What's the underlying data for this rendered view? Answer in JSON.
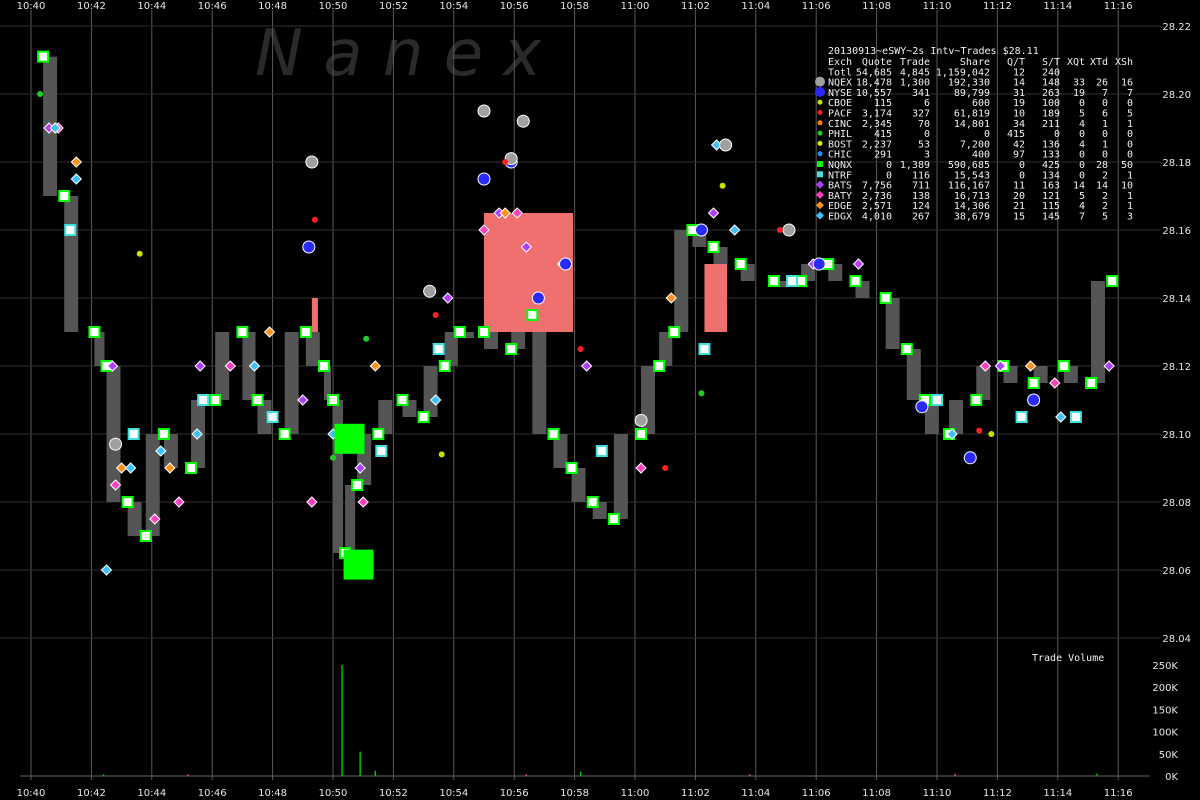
{
  "chart_data": {
    "type": "scatter",
    "title": "20130913~eSWY~2s Intv~Trades $28.11",
    "watermark": "N a n e x",
    "background": "#000000",
    "gridline_color": "#5a5a5a",
    "x_ticks": [
      "10:40",
      "10:42",
      "10:44",
      "10:46",
      "10:48",
      "10:50",
      "10:52",
      "10:54",
      "10:56",
      "10:58",
      "11:00",
      "11:02",
      "11:04",
      "11:06",
      "11:08",
      "11:10",
      "11:12",
      "11:14",
      "11:16"
    ],
    "x_range_minutes": [
      0,
      36.5
    ],
    "y_ticks": [
      "28.22",
      "28.20",
      "28.18",
      "28.16",
      "28.14",
      "28.12",
      "28.10",
      "28.08",
      "28.06",
      "28.04"
    ],
    "ylim": [
      28.04,
      28.22
    ],
    "volume_panel": {
      "label": "Trade Volume",
      "y_ticks": [
        "250K",
        "200K",
        "150K",
        "100K",
        "50K",
        "0K"
      ],
      "ylim": [
        0,
        250000
      ],
      "spikes": [
        {
          "t": 10.3,
          "v": 250000,
          "color": "#00c000"
        },
        {
          "t": 10.9,
          "v": 55000,
          "color": "#00c000"
        },
        {
          "t": 11.4,
          "v": 12000,
          "color": "#00c000"
        },
        {
          "t": 18.2,
          "v": 10000,
          "color": "#00c000"
        },
        {
          "t": 2.4,
          "v": 4000,
          "color": "#00c000"
        },
        {
          "t": 5.2,
          "v": 4000,
          "color": "#e05050"
        },
        {
          "t": 16.4,
          "v": 4000,
          "color": "#e05050"
        },
        {
          "t": 23.8,
          "v": 4000,
          "color": "#e05050"
        },
        {
          "t": 30.6,
          "v": 5000,
          "color": "#e05050"
        },
        {
          "t": 35.3,
          "v": 6000,
          "color": "#00c000"
        }
      ]
    },
    "legend": {
      "header": [
        "Exch",
        "Quote",
        "Trade",
        "Share",
        "Q/T",
        "S/T",
        "XQt",
        "XTd",
        "XSh"
      ],
      "rows": [
        {
          "marker": "none",
          "color": "#ffffff",
          "cells": [
            "Totl",
            "54,685",
            "4,845",
            "1,159,042",
            "12",
            "240",
            "",
            "",
            ""
          ]
        },
        {
          "marker": "circle",
          "color": "#a0a0a0",
          "cells": [
            "NQEX",
            "18,478",
            "1,300",
            "192,330",
            "14",
            "148",
            "33",
            "26",
            "16"
          ]
        },
        {
          "marker": "circle",
          "color": "#2a2aff",
          "cells": [
            "NYSE",
            "10,557",
            "341",
            "89,799",
            "31",
            "263",
            "19",
            "7",
            "7"
          ]
        },
        {
          "marker": "dot",
          "color": "#c8e000",
          "cells": [
            "CBOE",
            "115",
            "6",
            "600",
            "19",
            "100",
            "0",
            "0",
            "0"
          ]
        },
        {
          "marker": "dot",
          "color": "#ff2020",
          "cells": [
            "PACF",
            "3,174",
            "327",
            "61,819",
            "10",
            "189",
            "5",
            "6",
            "5"
          ]
        },
        {
          "marker": "dot",
          "color": "#ff8000",
          "cells": [
            "CINC",
            "2,345",
            "70",
            "14,801",
            "34",
            "211",
            "4",
            "1",
            "1"
          ]
        },
        {
          "marker": "dot",
          "color": "#20d020",
          "cells": [
            "PHIL",
            "415",
            "0",
            "0",
            "415",
            "0",
            "0",
            "0",
            "0"
          ]
        },
        {
          "marker": "dot",
          "color": "#d0f000",
          "cells": [
            "BOST",
            "2,237",
            "53",
            "7,200",
            "42",
            "136",
            "4",
            "1",
            "0"
          ]
        },
        {
          "marker": "dot",
          "color": "#2090ff",
          "cells": [
            "CHIC",
            "291",
            "3",
            "400",
            "97",
            "133",
            "0",
            "0",
            "0"
          ]
        },
        {
          "marker": "square",
          "color": "#00ff00",
          "cells": [
            "NQNX",
            "0",
            "1,389",
            "590,685",
            "0",
            "425",
            "0",
            "28",
            "50"
          ]
        },
        {
          "marker": "square",
          "color": "#40e0e0",
          "cells": [
            "NTRF",
            "0",
            "116",
            "15,543",
            "0",
            "134",
            "0",
            "2",
            "1"
          ]
        },
        {
          "marker": "diamond",
          "color": "#b040ff",
          "cells": [
            "BATS",
            "7,756",
            "711",
            "116,167",
            "11",
            "163",
            "14",
            "14",
            "10"
          ]
        },
        {
          "marker": "diamond",
          "color": "#ff40c0",
          "cells": [
            "BATY",
            "2,736",
            "138",
            "16,713",
            "20",
            "121",
            "5",
            "2",
            "1"
          ]
        },
        {
          "marker": "diamond",
          "color": "#ff9020",
          "cells": [
            "EDGE",
            "2,571",
            "124",
            "14,306",
            "21",
            "115",
            "4",
            "2",
            "1"
          ]
        },
        {
          "marker": "diamond",
          "color": "#40c0ff",
          "cells": [
            "EDGX",
            "4,010",
            "267",
            "38,679",
            "15",
            "145",
            "7",
            "5",
            "3"
          ]
        }
      ]
    },
    "series": [
      {
        "name": "NQNX",
        "marker": "square",
        "color": "#00ff00",
        "points": [
          [
            0.4,
            28.211
          ],
          [
            1.1,
            28.17
          ],
          [
            2.1,
            28.13
          ],
          [
            2.5,
            28.12
          ],
          [
            3.2,
            28.08
          ],
          [
            3.8,
            28.07
          ],
          [
            4.4,
            28.1
          ],
          [
            5.3,
            28.09
          ],
          [
            6.1,
            28.11
          ],
          [
            7.0,
            28.13
          ],
          [
            7.5,
            28.11
          ],
          [
            8.4,
            28.1
          ],
          [
            9.1,
            28.13
          ],
          [
            9.7,
            28.12
          ],
          [
            10.0,
            28.11
          ],
          [
            10.4,
            28.065
          ],
          [
            10.8,
            28.085
          ],
          [
            11.5,
            28.1
          ],
          [
            12.3,
            28.11
          ],
          [
            13.0,
            28.105
          ],
          [
            13.7,
            28.12
          ],
          [
            14.2,
            28.13
          ],
          [
            15.0,
            28.13
          ],
          [
            15.9,
            28.125
          ],
          [
            16.6,
            28.135
          ],
          [
            17.3,
            28.1
          ],
          [
            17.9,
            28.09
          ],
          [
            18.6,
            28.08
          ],
          [
            19.3,
            28.075
          ],
          [
            20.2,
            28.1
          ],
          [
            20.8,
            28.12
          ],
          [
            21.3,
            28.13
          ],
          [
            21.9,
            28.16
          ],
          [
            22.6,
            28.155
          ],
          [
            23.5,
            28.15
          ],
          [
            24.6,
            28.145
          ],
          [
            25.5,
            28.145
          ],
          [
            26.4,
            28.15
          ],
          [
            27.3,
            28.145
          ],
          [
            28.3,
            28.14
          ],
          [
            29.0,
            28.125
          ],
          [
            29.6,
            28.11
          ],
          [
            30.4,
            28.1
          ],
          [
            31.3,
            28.11
          ],
          [
            32.2,
            28.12
          ],
          [
            33.2,
            28.115
          ],
          [
            34.2,
            28.12
          ],
          [
            35.1,
            28.115
          ],
          [
            35.8,
            28.145
          ]
        ]
      },
      {
        "name": "NTRF",
        "marker": "square",
        "color": "#40e0e0",
        "points": [
          [
            1.3,
            28.16
          ],
          [
            3.4,
            28.1
          ],
          [
            5.7,
            28.11
          ],
          [
            8.0,
            28.105
          ],
          [
            11.6,
            28.095
          ],
          [
            13.5,
            28.125
          ],
          [
            18.9,
            28.095
          ],
          [
            22.3,
            28.125
          ],
          [
            25.2,
            28.145
          ],
          [
            30.0,
            28.11
          ],
          [
            32.8,
            28.105
          ],
          [
            34.6,
            28.105
          ]
        ]
      },
      {
        "name": "BATS",
        "marker": "diamond",
        "color": "#b040ff",
        "points": [
          [
            0.6,
            28.19
          ],
          [
            2.7,
            28.12
          ],
          [
            5.6,
            28.12
          ],
          [
            9.0,
            28.11
          ],
          [
            10.9,
            28.09
          ],
          [
            13.8,
            28.14
          ],
          [
            15.5,
            28.165
          ],
          [
            16.4,
            28.155
          ],
          [
            18.4,
            28.12
          ],
          [
            22.6,
            28.165
          ],
          [
            25.9,
            28.15
          ],
          [
            27.4,
            28.15
          ],
          [
            32.1,
            28.12
          ],
          [
            35.7,
            28.12
          ]
        ]
      },
      {
        "name": "BATY",
        "marker": "diamond",
        "color": "#ff40c0",
        "points": [
          [
            0.9,
            28.19
          ],
          [
            2.8,
            28.085
          ],
          [
            4.1,
            28.075
          ],
          [
            4.9,
            28.08
          ],
          [
            6.6,
            28.12
          ],
          [
            9.3,
            28.08
          ],
          [
            11.0,
            28.08
          ],
          [
            15.0,
            28.16
          ],
          [
            16.1,
            28.165
          ],
          [
            20.2,
            28.09
          ],
          [
            31.6,
            28.12
          ],
          [
            33.9,
            28.115
          ]
        ]
      },
      {
        "name": "EDGE",
        "marker": "diamond",
        "color": "#ff9020",
        "points": [
          [
            1.5,
            28.18
          ],
          [
            3.0,
            28.09
          ],
          [
            4.6,
            28.09
          ],
          [
            7.9,
            28.13
          ],
          [
            11.4,
            28.12
          ],
          [
            15.7,
            28.165
          ],
          [
            17.6,
            28.15
          ],
          [
            21.2,
            28.14
          ],
          [
            33.1,
            28.12
          ]
        ]
      },
      {
        "name": "EDGX",
        "marker": "diamond",
        "color": "#40c0ff",
        "points": [
          [
            0.8,
            28.19
          ],
          [
            1.5,
            28.175
          ],
          [
            2.5,
            28.06
          ],
          [
            3.3,
            28.09
          ],
          [
            4.3,
            28.095
          ],
          [
            5.5,
            28.1
          ],
          [
            7.4,
            28.12
          ],
          [
            10.0,
            28.1
          ],
          [
            13.4,
            28.11
          ],
          [
            22.7,
            28.185
          ],
          [
            23.3,
            28.16
          ],
          [
            30.5,
            28.1
          ],
          [
            34.1,
            28.105
          ]
        ]
      },
      {
        "name": "NYSE",
        "marker": "circle",
        "color": "#2a2aff",
        "points": [
          [
            9.2,
            28.155
          ],
          [
            15.0,
            28.175
          ],
          [
            15.9,
            28.18
          ],
          [
            17.7,
            28.15
          ],
          [
            22.2,
            28.16
          ],
          [
            26.1,
            28.15
          ],
          [
            29.5,
            28.108
          ],
          [
            31.1,
            28.093
          ],
          [
            33.2,
            28.11
          ],
          [
            16.8,
            28.14
          ]
        ]
      },
      {
        "name": "NQEX",
        "marker": "circle",
        "color": "#a0a0a0",
        "points": [
          [
            9.3,
            28.18
          ],
          [
            11.0,
            28.064
          ],
          [
            13.2,
            28.142
          ],
          [
            15.0,
            28.195
          ],
          [
            15.9,
            28.181
          ],
          [
            16.3,
            28.192
          ],
          [
            20.2,
            28.104
          ],
          [
            23.0,
            28.185
          ],
          [
            25.1,
            28.16
          ],
          [
            2.8,
            28.097
          ]
        ]
      },
      {
        "name": "PACF",
        "marker": "dot",
        "color": "#ff2020",
        "points": [
          [
            9.4,
            28.163
          ],
          [
            13.4,
            28.135
          ],
          [
            15.7,
            28.18
          ],
          [
            18.2,
            28.125
          ],
          [
            24.8,
            28.16
          ],
          [
            31.4,
            28.101
          ],
          [
            21.0,
            28.09
          ]
        ]
      },
      {
        "name": "CBOE",
        "marker": "dot",
        "color": "#c8e000",
        "points": [
          [
            3.6,
            28.153
          ],
          [
            22.9,
            28.173
          ],
          [
            13.6,
            28.094
          ],
          [
            31.8,
            28.1
          ]
        ]
      },
      {
        "name": "PHIL",
        "marker": "dot",
        "color": "#20d020",
        "points": [
          [
            0.3,
            28.2
          ],
          [
            10.0,
            28.093
          ],
          [
            11.1,
            28.128
          ],
          [
            22.2,
            28.112
          ]
        ]
      }
    ]
  }
}
